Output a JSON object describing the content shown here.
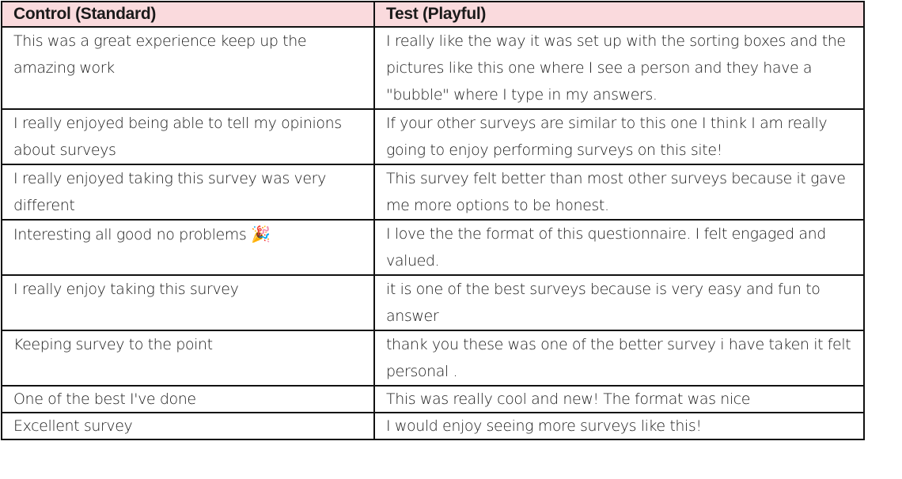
{
  "table": {
    "headers": [
      "Control (Standard)",
      "Test (Playful)"
    ],
    "header_bg_color": "#fadadd",
    "rows": [
      {
        "control": "This was a great experience keep up the amazing work",
        "test": "I really like the way it was set up with the sorting boxes and the pictures like this one where I see a person and they have a \"bubble\" where I type in my answers."
      },
      {
        "control": "I really enjoyed being able to tell my opinions about surveys",
        "test": "If your other surveys are similar to this one I think I am really going to enjoy performing surveys on this site!"
      },
      {
        "control": "I really enjoyed taking this survey was very different",
        "test": "This survey felt better than most other surveys because it gave me more options to be honest."
      },
      {
        "control": "Interesting all good no problems",
        "control_icon": "party-popper-icon",
        "control_icon_glyph": "🎉",
        "test": "I love the the format of this questionnaire. I felt engaged and valued."
      },
      {
        "control": "I really enjoy taking this survey",
        "test": "it is one of the best surveys because is very easy and fun to answer"
      },
      {
        "control": "Keeping survey to the point",
        "test": "thank you these was one of the better survey i have taken it felt personal ."
      },
      {
        "control": "One of the best I've done",
        "test": "This was really cool and new! The format was nice"
      },
      {
        "control": "Excellent survey",
        "test": "I would enjoy seeing more surveys like this!"
      }
    ]
  }
}
